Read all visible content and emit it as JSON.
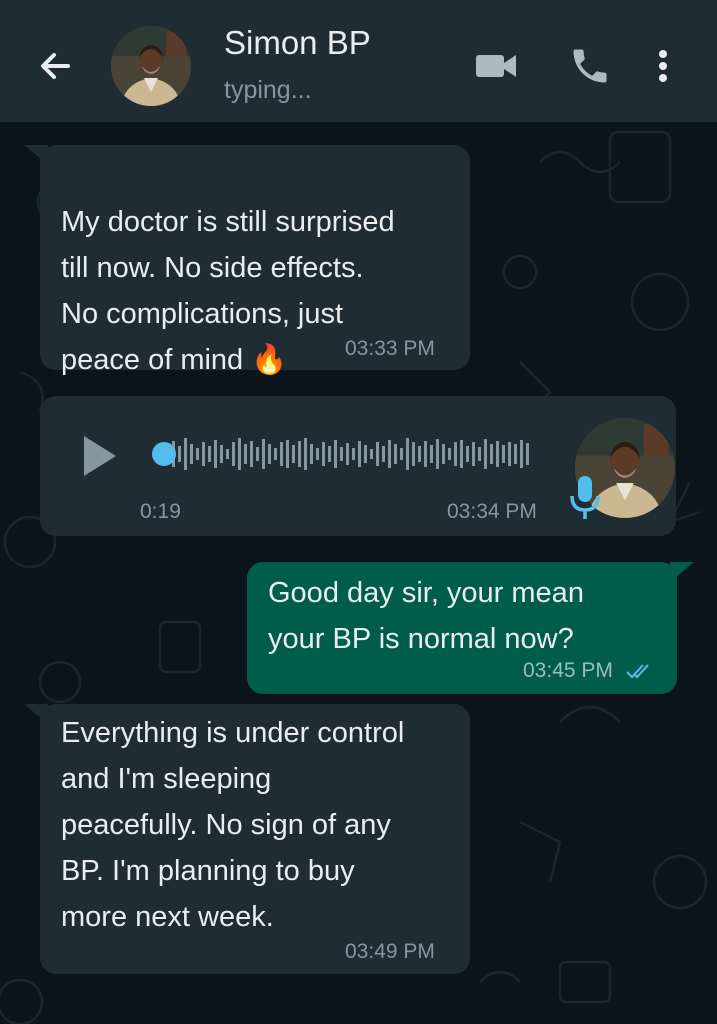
{
  "header": {
    "contact_name": "Simon BP",
    "status": "typing...",
    "icons": [
      "back-arrow-icon",
      "video-camera-icon",
      "phone-icon",
      "more-vertical-icon"
    ]
  },
  "messages": [
    {
      "direction": "incoming",
      "text": "My doctor is still surprised\ntill now. No side effects.\nNo complications, just\npeace of mind",
      "emoji": "🔥",
      "time": "03:33 PM"
    },
    {
      "direction": "incoming",
      "type": "voice-note",
      "duration": "0:19",
      "time": "03:34 PM",
      "progress": 0
    },
    {
      "direction": "outgoing",
      "text": "Good day sir, your mean\nyour BP is normal now?",
      "time": "03:45 PM",
      "status": "read"
    },
    {
      "direction": "incoming",
      "text": "Everything is under control\nand I'm sleeping\npeacefully. No sign of any\nBP. I'm planning to buy\nmore next week.",
      "time": "03:49 PM"
    }
  ],
  "colors": {
    "header_bg": "#1f2c33",
    "chat_bg": "#0b141a",
    "incoming_bubble": "#202c33",
    "outgoing_bubble": "#005c4b",
    "accent_blue": "#53bdeb"
  }
}
